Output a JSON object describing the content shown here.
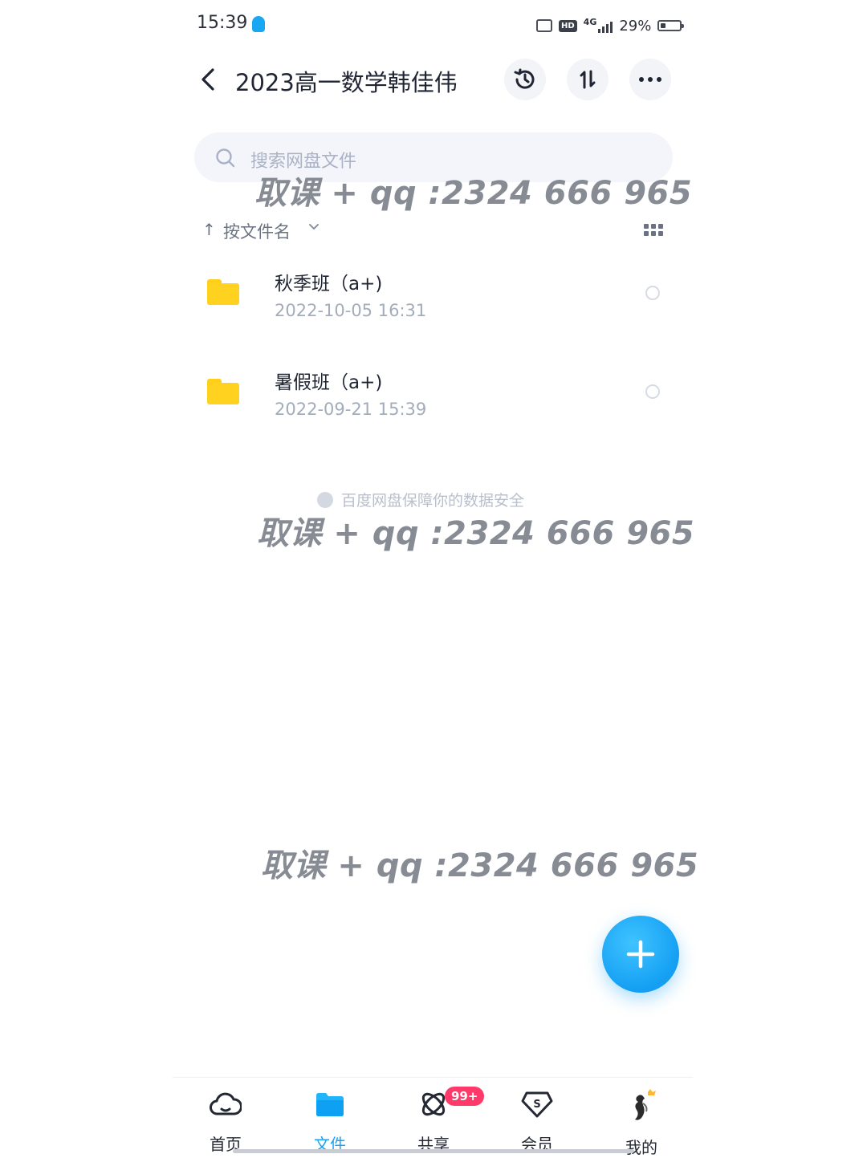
{
  "status_bar": {
    "time": "15:39",
    "network": "4G",
    "hd": "HD",
    "battery_percent": "29%",
    "battery_level": 0.29,
    "icons": [
      "qq-bell-icon",
      "vibrate-icon",
      "hd-icon",
      "signal-icon",
      "battery-icon"
    ]
  },
  "header": {
    "title": "2023高一数学韩佳伟",
    "icons": [
      "back-icon",
      "history-icon",
      "transfer-icon",
      "more-icon"
    ]
  },
  "search": {
    "placeholder": "搜索网盘文件"
  },
  "sort": {
    "label": "按文件名"
  },
  "files": [
    {
      "name": "秋季班（a+)",
      "date": "2022-10-05  16:31"
    },
    {
      "name": "暑假班（a+)",
      "date": "2022-09-21  15:39"
    }
  ],
  "safety_notice": "百度网盘保障你的数据安全",
  "watermark": "取课 + qq :2324 666 965",
  "nav": {
    "items": [
      {
        "label": "首页",
        "icon": "cloud-home-icon"
      },
      {
        "label": "文件",
        "icon": "folder-icon"
      },
      {
        "label": "共享",
        "icon": "share-planet-icon"
      },
      {
        "label": "会员",
        "icon": "vip-icon"
      },
      {
        "label": "我的",
        "icon": "avatar"
      }
    ],
    "active_index": 1,
    "share_badge": "99+"
  },
  "colors": {
    "accent": "#1aa2f5",
    "folder": "#ffd21f",
    "badge": "#ff3a6a"
  }
}
